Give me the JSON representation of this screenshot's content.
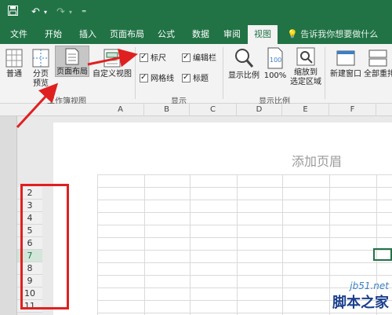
{
  "ribbon_tabs": [
    {
      "label": "文件"
    },
    {
      "label": "开始"
    },
    {
      "label": "插入"
    },
    {
      "label": "页面布局"
    },
    {
      "label": "公式"
    },
    {
      "label": "数据"
    },
    {
      "label": "审阅"
    },
    {
      "label": "视图",
      "active": true
    }
  ],
  "tell_me": "告诉我你想要做什么",
  "workbook_views": {
    "normal": "普通",
    "page_break_line1": "分页",
    "page_break_line2": "预览",
    "page_layout": "页面布局",
    "custom_views": "自定义视图",
    "group_label": "工作簿视图"
  },
  "show": {
    "ruler": "标尺",
    "formula_bar": "编辑栏",
    "gridlines": "网格线",
    "headings": "标题",
    "group_label": "显示"
  },
  "zoom": {
    "zoom": "显示比例",
    "zoom_100": "100%",
    "zoom_selection_line1": "缩放到",
    "zoom_selection_line2": "选定区域",
    "group_label": "显示比例"
  },
  "window": {
    "new_window": "新建窗口",
    "arrange_all": "全部重排"
  },
  "columns": [
    "A",
    "B",
    "C",
    "D",
    "E",
    "F"
  ],
  "page_header_placeholder": "添加页眉",
  "rows": [
    "2",
    "3",
    "4",
    "5",
    "6",
    "7",
    "8",
    "9",
    "10",
    "11"
  ],
  "selected_row": "7",
  "watermark": {
    "domain": "jb51.net",
    "name": "脚本之家"
  },
  "colors": {
    "excel_green": "#217346",
    "annotation_red": "#e02020"
  }
}
